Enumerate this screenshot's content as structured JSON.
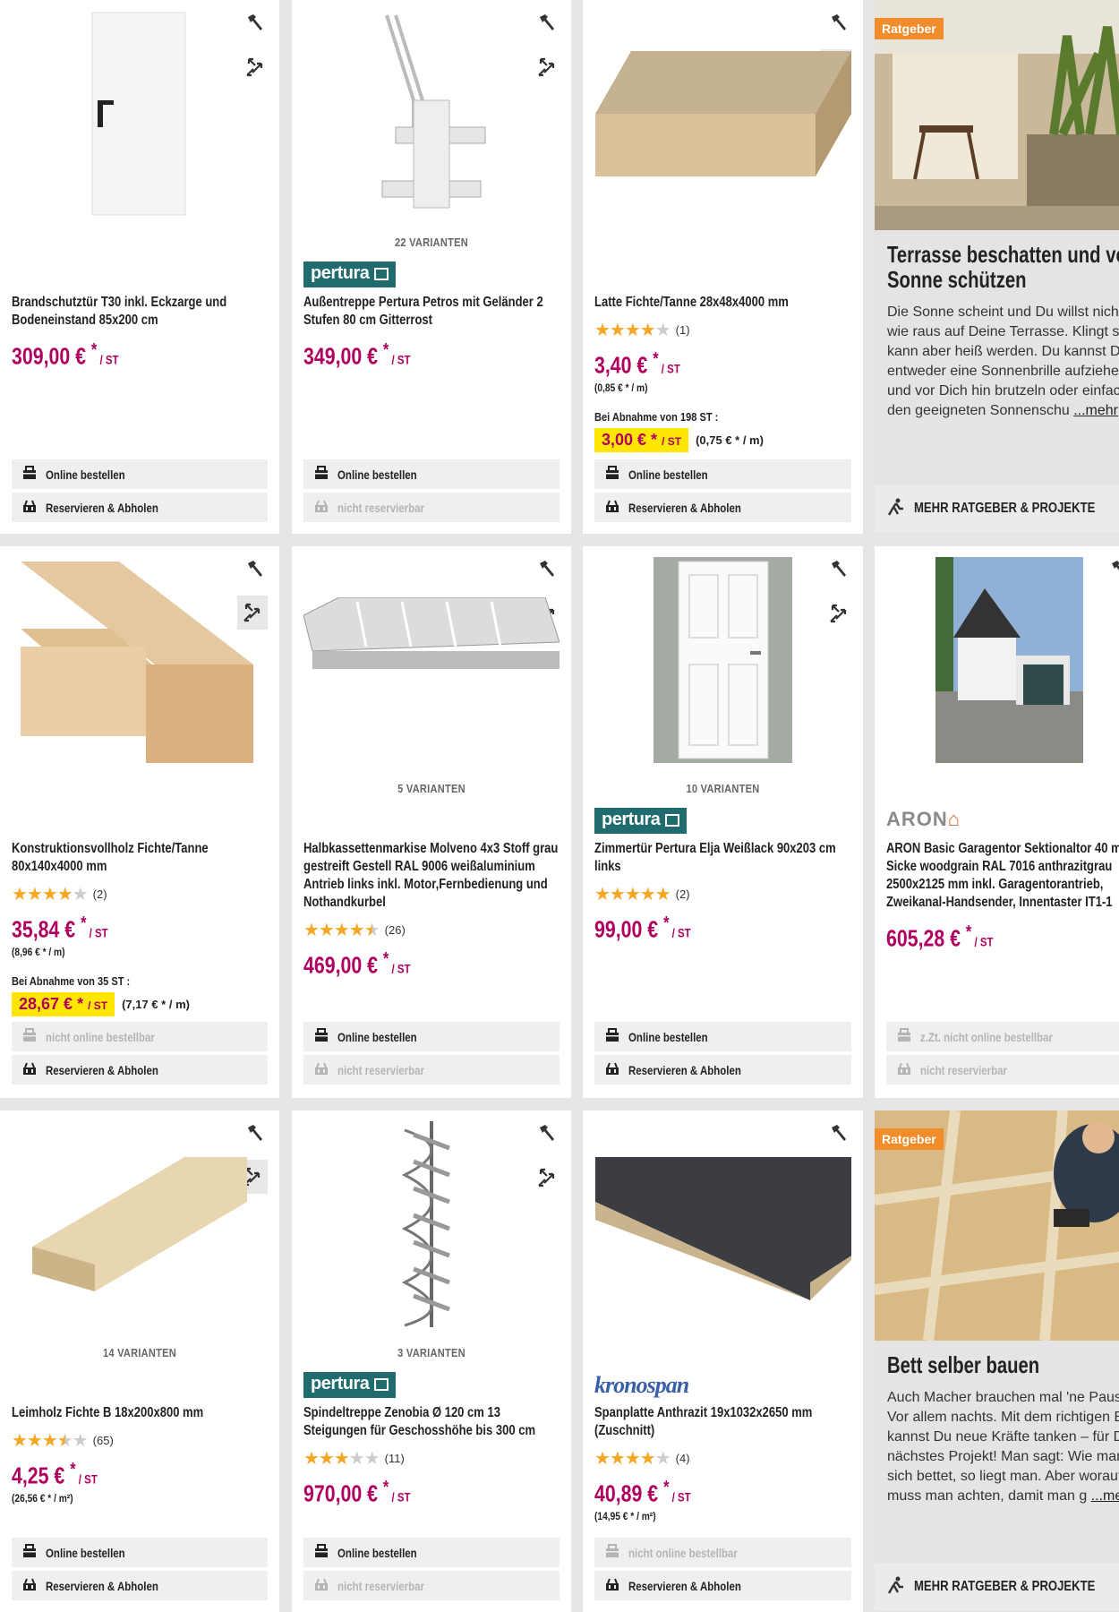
{
  "products": [
    {
      "id": "p1",
      "variants": "",
      "brand": "",
      "title": "Brandschutztür T30 inkl. Eckzarge und Bodeneinstand 85x200 cm",
      "stars": 0,
      "reviews": "",
      "price": "309,00 €",
      "unit": "/ ST",
      "base": "",
      "bulk_label": "",
      "bulk_price": "",
      "bulk_base": "",
      "btn_online": "Online bestellen",
      "btn_online_enabled": true,
      "btn_reserve": "Reservieren & Abholen",
      "btn_reserve_enabled": true
    },
    {
      "id": "p2",
      "variants": "22 VARIANTEN",
      "brand": "pertura",
      "title": "Außentreppe Pertura Petros mit Geländer 2 Stufen 80 cm Gitterrost",
      "stars": 0,
      "reviews": "",
      "price": "349,00 €",
      "unit": "/ ST",
      "base": "",
      "btn_online": "Online bestellen",
      "btn_online_enabled": true,
      "btn_reserve": "nicht reservierbar",
      "btn_reserve_enabled": false
    },
    {
      "id": "p3",
      "variants": "",
      "brand": "",
      "title": "Latte Fichte/Tanne 28x48x4000 mm",
      "stars": 4,
      "reviews": "(1)",
      "price": "3,40 €",
      "unit": "/ ST",
      "base": "(0,85 € * / m)",
      "bulk_label": "Bei Abnahme von 198 ST :",
      "bulk_price": "3,00 €",
      "bulk_base": "(0,75 € * / m)",
      "btn_online": "Online bestellen",
      "btn_online_enabled": true,
      "btn_reserve": "Reservieren & Abholen",
      "btn_reserve_enabled": true
    },
    {
      "id": "p4",
      "variants": "",
      "brand": "",
      "title": "Konstruktionsvollholz Fichte/Tanne 80x140x4000 mm",
      "stars": 4,
      "reviews": "(2)",
      "price": "35,84 €",
      "unit": "/ ST",
      "base": "(8,96 € * / m)",
      "bulk_label": "Bei Abnahme von 35 ST :",
      "bulk_price": "28,67 €",
      "bulk_base": "(7,17 € * / m)",
      "btn_online": "nicht online bestellbar",
      "btn_online_enabled": false,
      "btn_reserve": "Reservieren & Abholen",
      "btn_reserve_enabled": true
    },
    {
      "id": "p5",
      "variants": "5 VARIANTEN",
      "brand": "",
      "title": "Halbkassettenmarkise Molveno 4x3 Stoff grau gestreift Gestell RAL 9006 weißaluminium Antrieb links inkl. Motor,Fernbedienung und Nothandkurbel",
      "stars": 4.5,
      "reviews": "(26)",
      "price": "469,00 €",
      "unit": "/ ST",
      "base": "",
      "btn_online": "Online bestellen",
      "btn_online_enabled": true,
      "btn_reserve": "nicht reservierbar",
      "btn_reserve_enabled": false
    },
    {
      "id": "p6",
      "variants": "10 VARIANTEN",
      "brand": "pertura",
      "title": "Zimmertür Pertura Elja Weißlack 90x203 cm links",
      "stars": 5,
      "reviews": "(2)",
      "price": "99,00 €",
      "unit": "/ ST",
      "base": "",
      "btn_online": "Online bestellen",
      "btn_online_enabled": true,
      "btn_reserve": "Reservieren & Abholen",
      "btn_reserve_enabled": true
    },
    {
      "id": "p7",
      "variants": "",
      "brand": "ARON",
      "title": "ARON Basic Garagentor Sektionaltor 40 mm M-Sicke woodgrain RAL 7016 anthrazitgrau 2500x2125 mm inkl. Garagentorantrieb, Zweikanal-Handsender, Innentaster IT1-1",
      "stars": 0,
      "reviews": "",
      "price": "605,28 €",
      "unit": "/ ST",
      "base": "",
      "btn_online": "z.Zt. nicht online bestellbar",
      "btn_online_enabled": false,
      "btn_reserve": "nicht reservierbar",
      "btn_reserve_enabled": false
    },
    {
      "id": "p8",
      "variants": "14 VARIANTEN",
      "brand": "",
      "title": "Leimholz Fichte B 18x200x800 mm",
      "stars": 3.5,
      "reviews": "(65)",
      "price": "4,25 €",
      "unit": "/ ST",
      "base": "(26,56 € * / m²)",
      "btn_online": "Online bestellen",
      "btn_online_enabled": true,
      "btn_reserve": "Reservieren & Abholen",
      "btn_reserve_enabled": true
    },
    {
      "id": "p9",
      "variants": "3 VARIANTEN",
      "brand": "pertura",
      "title": "Spindeltreppe Zenobia Ø 120 cm 13 Steigungen für Geschosshöhe bis 300 cm",
      "stars": 3,
      "reviews": "(11)",
      "price": "970,00 €",
      "unit": "/ ST",
      "base": "",
      "btn_online": "Online bestellen",
      "btn_online_enabled": true,
      "btn_reserve": "nicht reservierbar",
      "btn_reserve_enabled": false
    },
    {
      "id": "p10",
      "variants": "",
      "brand": "kronospan",
      "title": "Spanplatte Anthrazit 19x1032x2650 mm (Zuschnitt)",
      "stars": 4,
      "reviews": "(4)",
      "price": "40,89 €",
      "unit": "/ ST",
      "base": "(14,95 € * / m²)",
      "btn_online": "nicht online bestellbar",
      "btn_online_enabled": false,
      "btn_reserve": "Reservieren & Abholen",
      "btn_reserve_enabled": true
    }
  ],
  "ratgeber": [
    {
      "badge": "Ratgeber",
      "title": "Terrasse beschatten und vor Sonne schützen",
      "text": [
        "Die Sonne scheint und Du willst nichts",
        "wie raus auf Deine Terrasse. Klingt su",
        "kann aber heiß werden. Du kannst Dir",
        "entweder eine Sonnenbrille aufziehen",
        "und vor Dich hin brutzeln oder einfach",
        "den geeigneten Sonnenschu"
      ],
      "more": "...mehr",
      "footer": "MEHR RATGEBER & PROJEKTE"
    },
    {
      "badge": "Ratgeber",
      "title": "Bett selber bauen",
      "text": [
        "Auch Macher brauchen mal 'ne Pause",
        "Vor allem nachts. Mit dem richtigen Be",
        "kannst Du neue Kräfte tanken – für De",
        "nächstes Projekt! Man sagt: Wie man",
        "sich bettet, so liegt man. Aber worauf",
        "muss man achten, damit man g"
      ],
      "more": "...meh",
      "footer": "MEHR RATGEBER & PROJEKTE"
    }
  ],
  "brands": {
    "pertura": "pertura",
    "kronospan": "kronospan",
    "aron_a": "ARON"
  },
  "colors": {
    "price": "#b0005f",
    "star": "#f5a623",
    "highlight": "#ffe600",
    "badge": "#f08c2a",
    "pertura": "#1f6b6e",
    "kronospan": "#3a5fa8"
  },
  "icons": {
    "wishlist": "hammer-icon",
    "compare": "compare-arrows-icon",
    "online": "cart-box-icon",
    "reserve": "store-basket-icon",
    "ratgeber": "worker-icon"
  }
}
